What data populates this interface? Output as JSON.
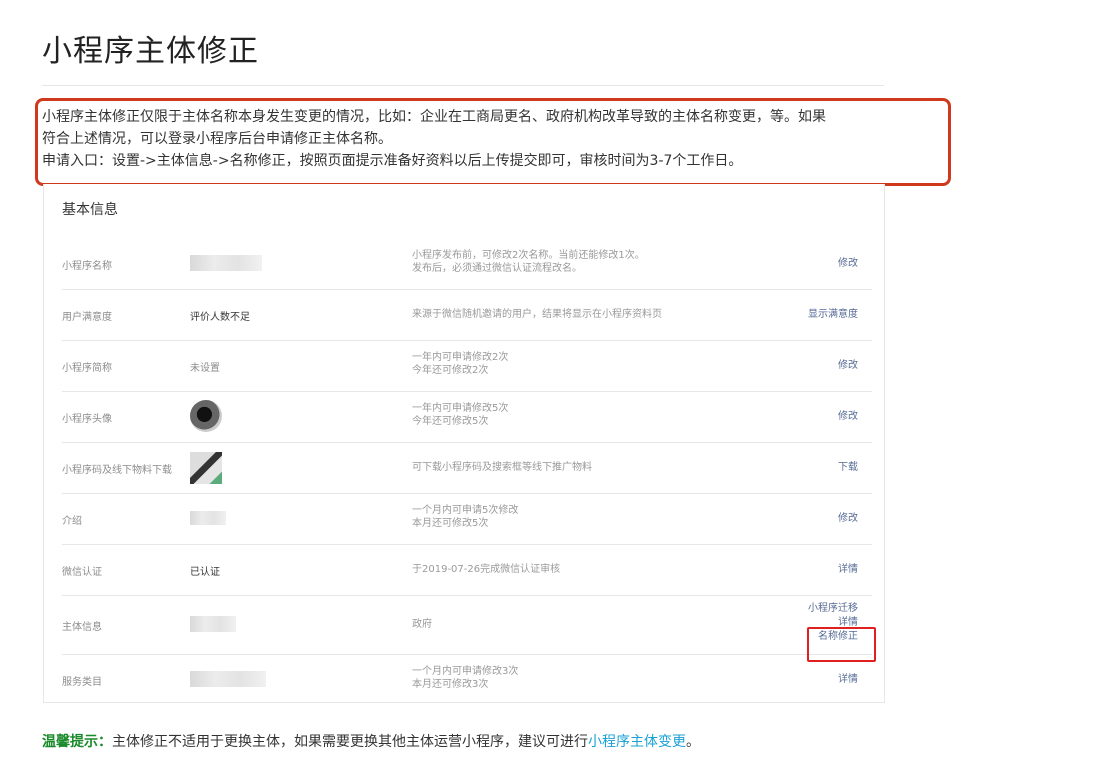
{
  "page": {
    "title": "小程序主体修正"
  },
  "intro": {
    "line1": "小程序主体修正仅限于主体名称本身发生变更的情况，比如：企业在工商局更名、政府机构改革导致的主体名称变更，等。如果",
    "line2": "符合上述情况，可以登录小程序后台申请修正主体名称。",
    "line3": "申请入口：设置->主体信息->名称修正，按照页面提示准备好资料以后上传提交即可，审核时间为3-7个工作日。"
  },
  "panel": {
    "title": "基本信息",
    "rows": [
      {
        "label": "小程序名称",
        "value": "",
        "desc1": "小程序发布前，可修改2次名称。当前还能修改1次。",
        "desc2": "发布后，必须通过微信认证流程改名。",
        "action": "修改"
      },
      {
        "label": "用户满意度",
        "value": "评价人数不足",
        "desc1": "来源于微信随机邀请的用户，结果将显示在小程序资料页",
        "desc2": "",
        "action": "显示满意度"
      },
      {
        "label": "小程序简称",
        "value": "未设置",
        "desc1": "一年内可申请修改2次",
        "desc2": "今年还可修改2次",
        "action": "修改"
      },
      {
        "label": "小程序头像",
        "value": "",
        "desc1": "一年内可申请修改5次",
        "desc2": "今年还可修改5次",
        "action": "修改"
      },
      {
        "label": "小程序码及线下物料下载",
        "value": "",
        "desc1": "可下载小程序码及搜索框等线下推广物料",
        "desc2": "",
        "action": "下载"
      },
      {
        "label": "介绍",
        "value": "",
        "desc1": "一个月内可申请5次修改",
        "desc2": "本月还可修改5次",
        "action": "修改"
      },
      {
        "label": "微信认证",
        "value": "已认证",
        "desc1": "于2019-07-26完成微信认证审核",
        "desc2": "",
        "action": "详情"
      },
      {
        "label": "主体信息",
        "value": "",
        "desc1": "政府",
        "desc2": "",
        "action1": "小程序迁移",
        "action2": "详情",
        "action3": "名称修正"
      },
      {
        "label": "服务类目",
        "value": "",
        "desc1": "一个月内可申请修改3次",
        "desc2": "本月还可修改3次",
        "action": "详情"
      }
    ]
  },
  "tip": {
    "label": "温馨提示：",
    "text": "主体修正不适用于更换主体，如果需要更换其他主体运营小程序，建议可进行",
    "link": "小程序主体变更",
    "end": "。"
  },
  "colors": {
    "highlight_border": "#d0391e",
    "link": "#576b95",
    "tip_label": "#1a8a2a",
    "tip_link": "#1aa0d6"
  }
}
